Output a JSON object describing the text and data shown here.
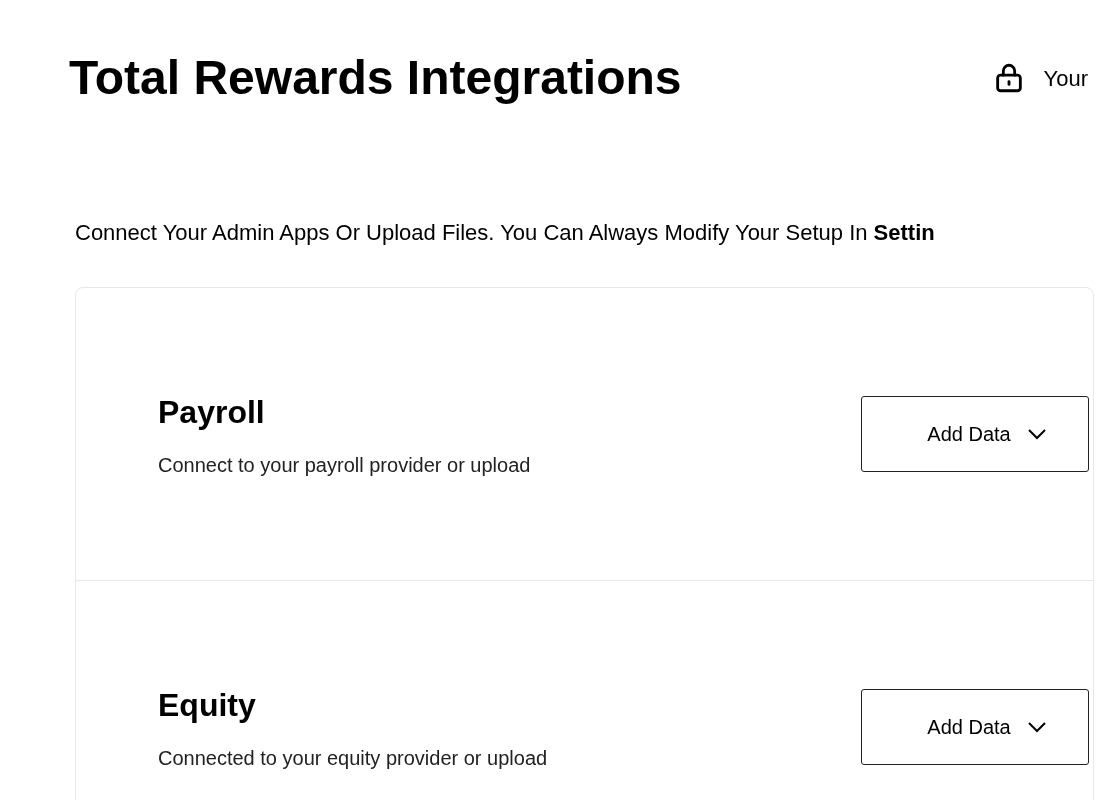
{
  "page": {
    "title": "Total Rewards Integrations",
    "lock_label": "Your"
  },
  "intro": "Connect Your Admin Apps Or Upload Files. You Can Always Modify Your Setup In **Settin**",
  "sections": [
    {
      "title": "Payroll",
      "description": "Connect to your payroll provider or upload",
      "button": "Add Data"
    },
    {
      "title": "Equity",
      "description": "Connected to your equity provider or upload",
      "button": "Add Data"
    }
  ]
}
